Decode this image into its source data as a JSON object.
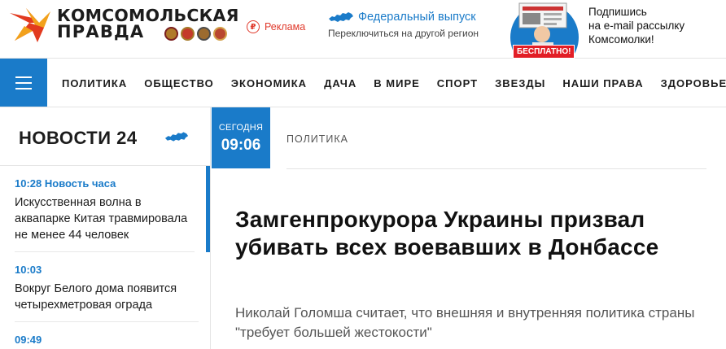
{
  "header": {
    "logo": {
      "line1": "КОМСОМОЛЬСКАЯ",
      "line2": "ПРАВДА"
    },
    "ad_label": "Реклама",
    "ad_icon": "ruble-circle-icon",
    "region": {
      "title": "Федеральный выпуск",
      "subtitle": "Переключиться на другой регион"
    },
    "promo": {
      "badge": "БЕСПЛАТНО!",
      "text": [
        "Подпишись",
        "на e-mail рассылку",
        "Комсомолки!"
      ]
    }
  },
  "nav": {
    "items": [
      "ПОЛИТИКА",
      "ОБЩЕСТВО",
      "ЭКОНОМИКА",
      "ДАЧА",
      "В МИРЕ",
      "СПОРТ",
      "ЗВЕЗДЫ",
      "НАШИ ПРАВА",
      "ЗДОРОВЬЕ"
    ]
  },
  "sidebar": {
    "title": "НОВОСТИ 24",
    "feed": [
      {
        "time": "10:28",
        "tag": "Новость часа",
        "text": "Искусственная волна в аквапарке Китая травмировала не менее 44 человек"
      },
      {
        "time": "10:03",
        "text": "Вокруг Белого дома появится четырехметровая ограда"
      },
      {
        "time": "09:49"
      }
    ]
  },
  "article": {
    "date_day": "СЕГОДНЯ",
    "date_time": "09:06",
    "rubric": "ПОЛИТИКА",
    "headline": "Замгенпрокурора Украины призвал убивать всех воевавших в Донбассе",
    "lead": "Николай Голомша считает, что внешняя и внутренняя политика страны \"требует большей жестокости\""
  },
  "colors": {
    "accent": "#1a7bc9",
    "ad_red": "#e0392b",
    "promo_red": "#e21e26",
    "logo_star_red": "#e23a1f",
    "logo_star_orange": "#f2a11c"
  }
}
